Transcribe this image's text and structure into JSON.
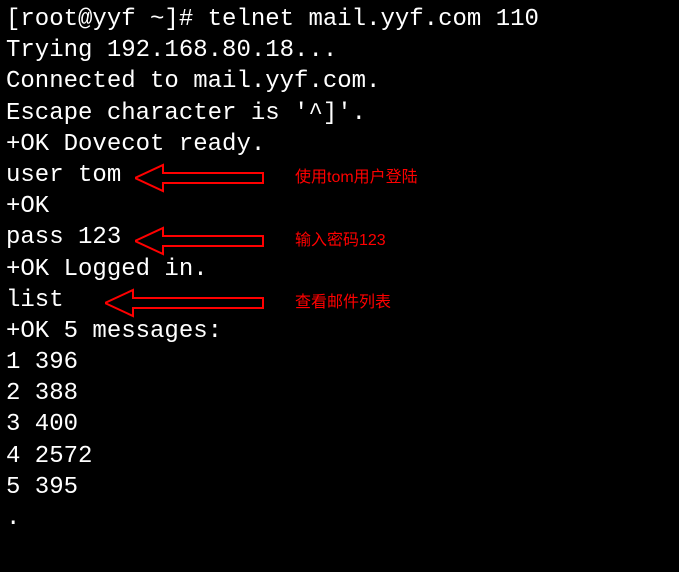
{
  "terminal": {
    "prompt": "[root@yyf ~]# ",
    "command": "telnet mail.yyf.com 110",
    "lines": [
      "Trying 192.168.80.18...",
      "Connected to mail.yyf.com.",
      "Escape character is '^]'.",
      "+OK Dovecot ready.",
      "user tom",
      "+OK",
      "pass 123",
      "+OK Logged in.",
      "list",
      "+OK 5 messages:",
      "1 396",
      "2 388",
      "3 400",
      "4 2572",
      "5 395",
      "."
    ]
  },
  "annotations": [
    {
      "text": "使用tom用户登陆"
    },
    {
      "text": "输入密码123"
    },
    {
      "text": "查看邮件列表"
    }
  ]
}
